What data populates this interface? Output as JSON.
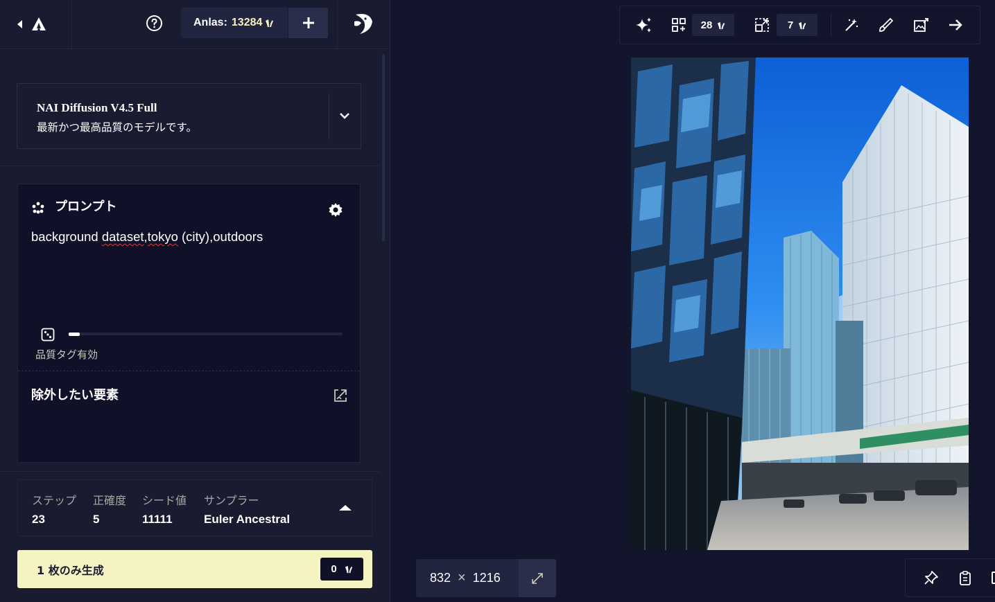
{
  "header": {
    "anlas_label": "Anlas:",
    "anlas_value": "13284"
  },
  "model": {
    "name": "NAI Diffusion V4.5 Full",
    "description": "最新かつ最高品質のモデルです。"
  },
  "prompt": {
    "title": "プロンプト",
    "text_parts": [
      "background ",
      "dataset",
      ",",
      "tokyo",
      " (city),outdoors"
    ],
    "quality_label": "品質タグ有効",
    "quality_slider_fraction": 0.04,
    "negative_title": "除外したい要素"
  },
  "settings": [
    {
      "label": "ステップ",
      "value": "23"
    },
    {
      "label": "正確度",
      "value": "5"
    },
    {
      "label": "シード値",
      "value": "11111"
    },
    {
      "label": "サンプラー",
      "value": "Euler Ancestral"
    }
  ],
  "generate": {
    "label": "1 枚のみ生成",
    "cost": "0"
  },
  "toolbar": {
    "variations_cost": "28",
    "upscale_cost": "7"
  },
  "image": {
    "width": "832",
    "separator": "×",
    "height": "1216"
  },
  "colors": {
    "accent": "#f5f3c2",
    "panel": "#191b31",
    "background": "#13152c",
    "input": "#101128"
  }
}
